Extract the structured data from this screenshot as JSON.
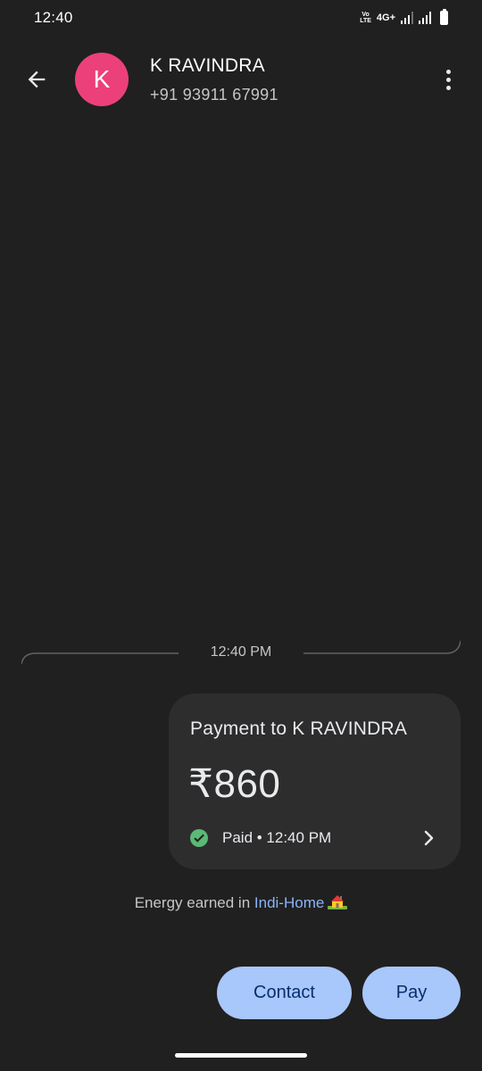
{
  "status_bar": {
    "time": "12:40",
    "volte_label": "VoLTE",
    "network_type": "4G+"
  },
  "header": {
    "avatar_letter": "K",
    "avatar_color": "#ec407a",
    "contact_name": "K RAVINDRA",
    "contact_phone": "+91 93911 67991"
  },
  "conversation": {
    "timestamp": "12:40 PM",
    "payment": {
      "title": "Payment to K RAVINDRA",
      "amount": "₹860",
      "status": "Paid • 12:40 PM",
      "status_icon": "check-circle-icon",
      "status_color": "#5bb974"
    },
    "energy": {
      "prefix": "Energy earned in ",
      "link": "Indi-Home",
      "icon": "house-icon"
    }
  },
  "actions": {
    "contact_label": "Contact",
    "pay_label": "Pay",
    "button_color": "#a8c7fa"
  }
}
